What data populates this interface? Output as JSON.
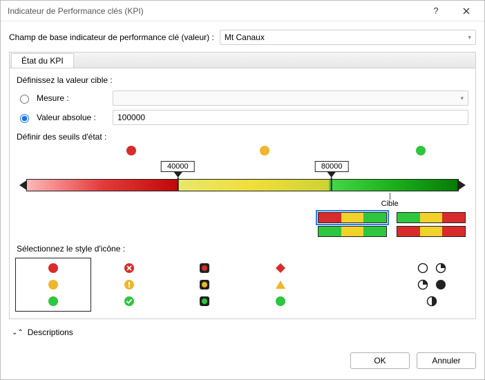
{
  "window": {
    "title": "Indicateur de Performance clés (KPI)"
  },
  "base": {
    "label": "Champ de base indicateur de performance clé (valeur) :",
    "value": "Mt Canaux"
  },
  "tab": {
    "label": "État du KPI"
  },
  "target": {
    "define_label": "Définissez la valeur cible :",
    "measure_label": "Mesure :",
    "measure_value": "",
    "absolute_label": "Valeur absolue :",
    "absolute_value": "100000",
    "selected": "absolute"
  },
  "thresholds": {
    "label": "Définir des seuils d'état :",
    "marker1": "40000",
    "marker2": "80000",
    "target_label": "Cible"
  },
  "iconstyle": {
    "label": "Sélectionnez le style d'icône :"
  },
  "descriptions": {
    "label": "Descriptions"
  },
  "buttons": {
    "ok": "OK",
    "cancel": "Annuler"
  }
}
